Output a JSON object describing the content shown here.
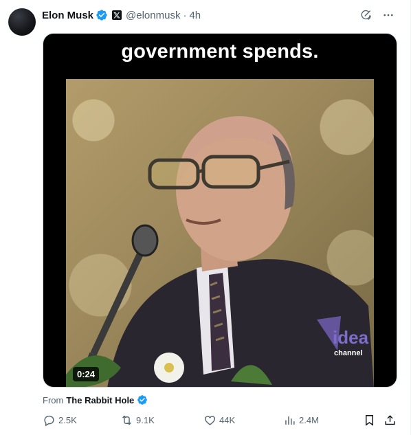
{
  "author": {
    "name": "Elon Musk",
    "handle": "@elonmusk",
    "separator": "·",
    "time": "4h"
  },
  "media": {
    "caption": "government spends.",
    "duration": "0:24",
    "watermark": {
      "brand": "idea",
      "sub": "channel"
    }
  },
  "source": {
    "prefix": "From",
    "name": "The Rabbit Hole"
  },
  "actions": {
    "replies": "2.5K",
    "reposts": "9.1K",
    "likes": "44K",
    "views": "2.4M"
  },
  "colors": {
    "verified": "#1d9bf0",
    "muted": "#536471",
    "text": "#0f1419"
  },
  "icons": [
    "verified-badge-icon",
    "x-logo-icon",
    "grok-icon",
    "more-icon",
    "reply-icon",
    "repost-icon",
    "like-icon",
    "views-icon",
    "bookmark-icon",
    "share-icon"
  ]
}
